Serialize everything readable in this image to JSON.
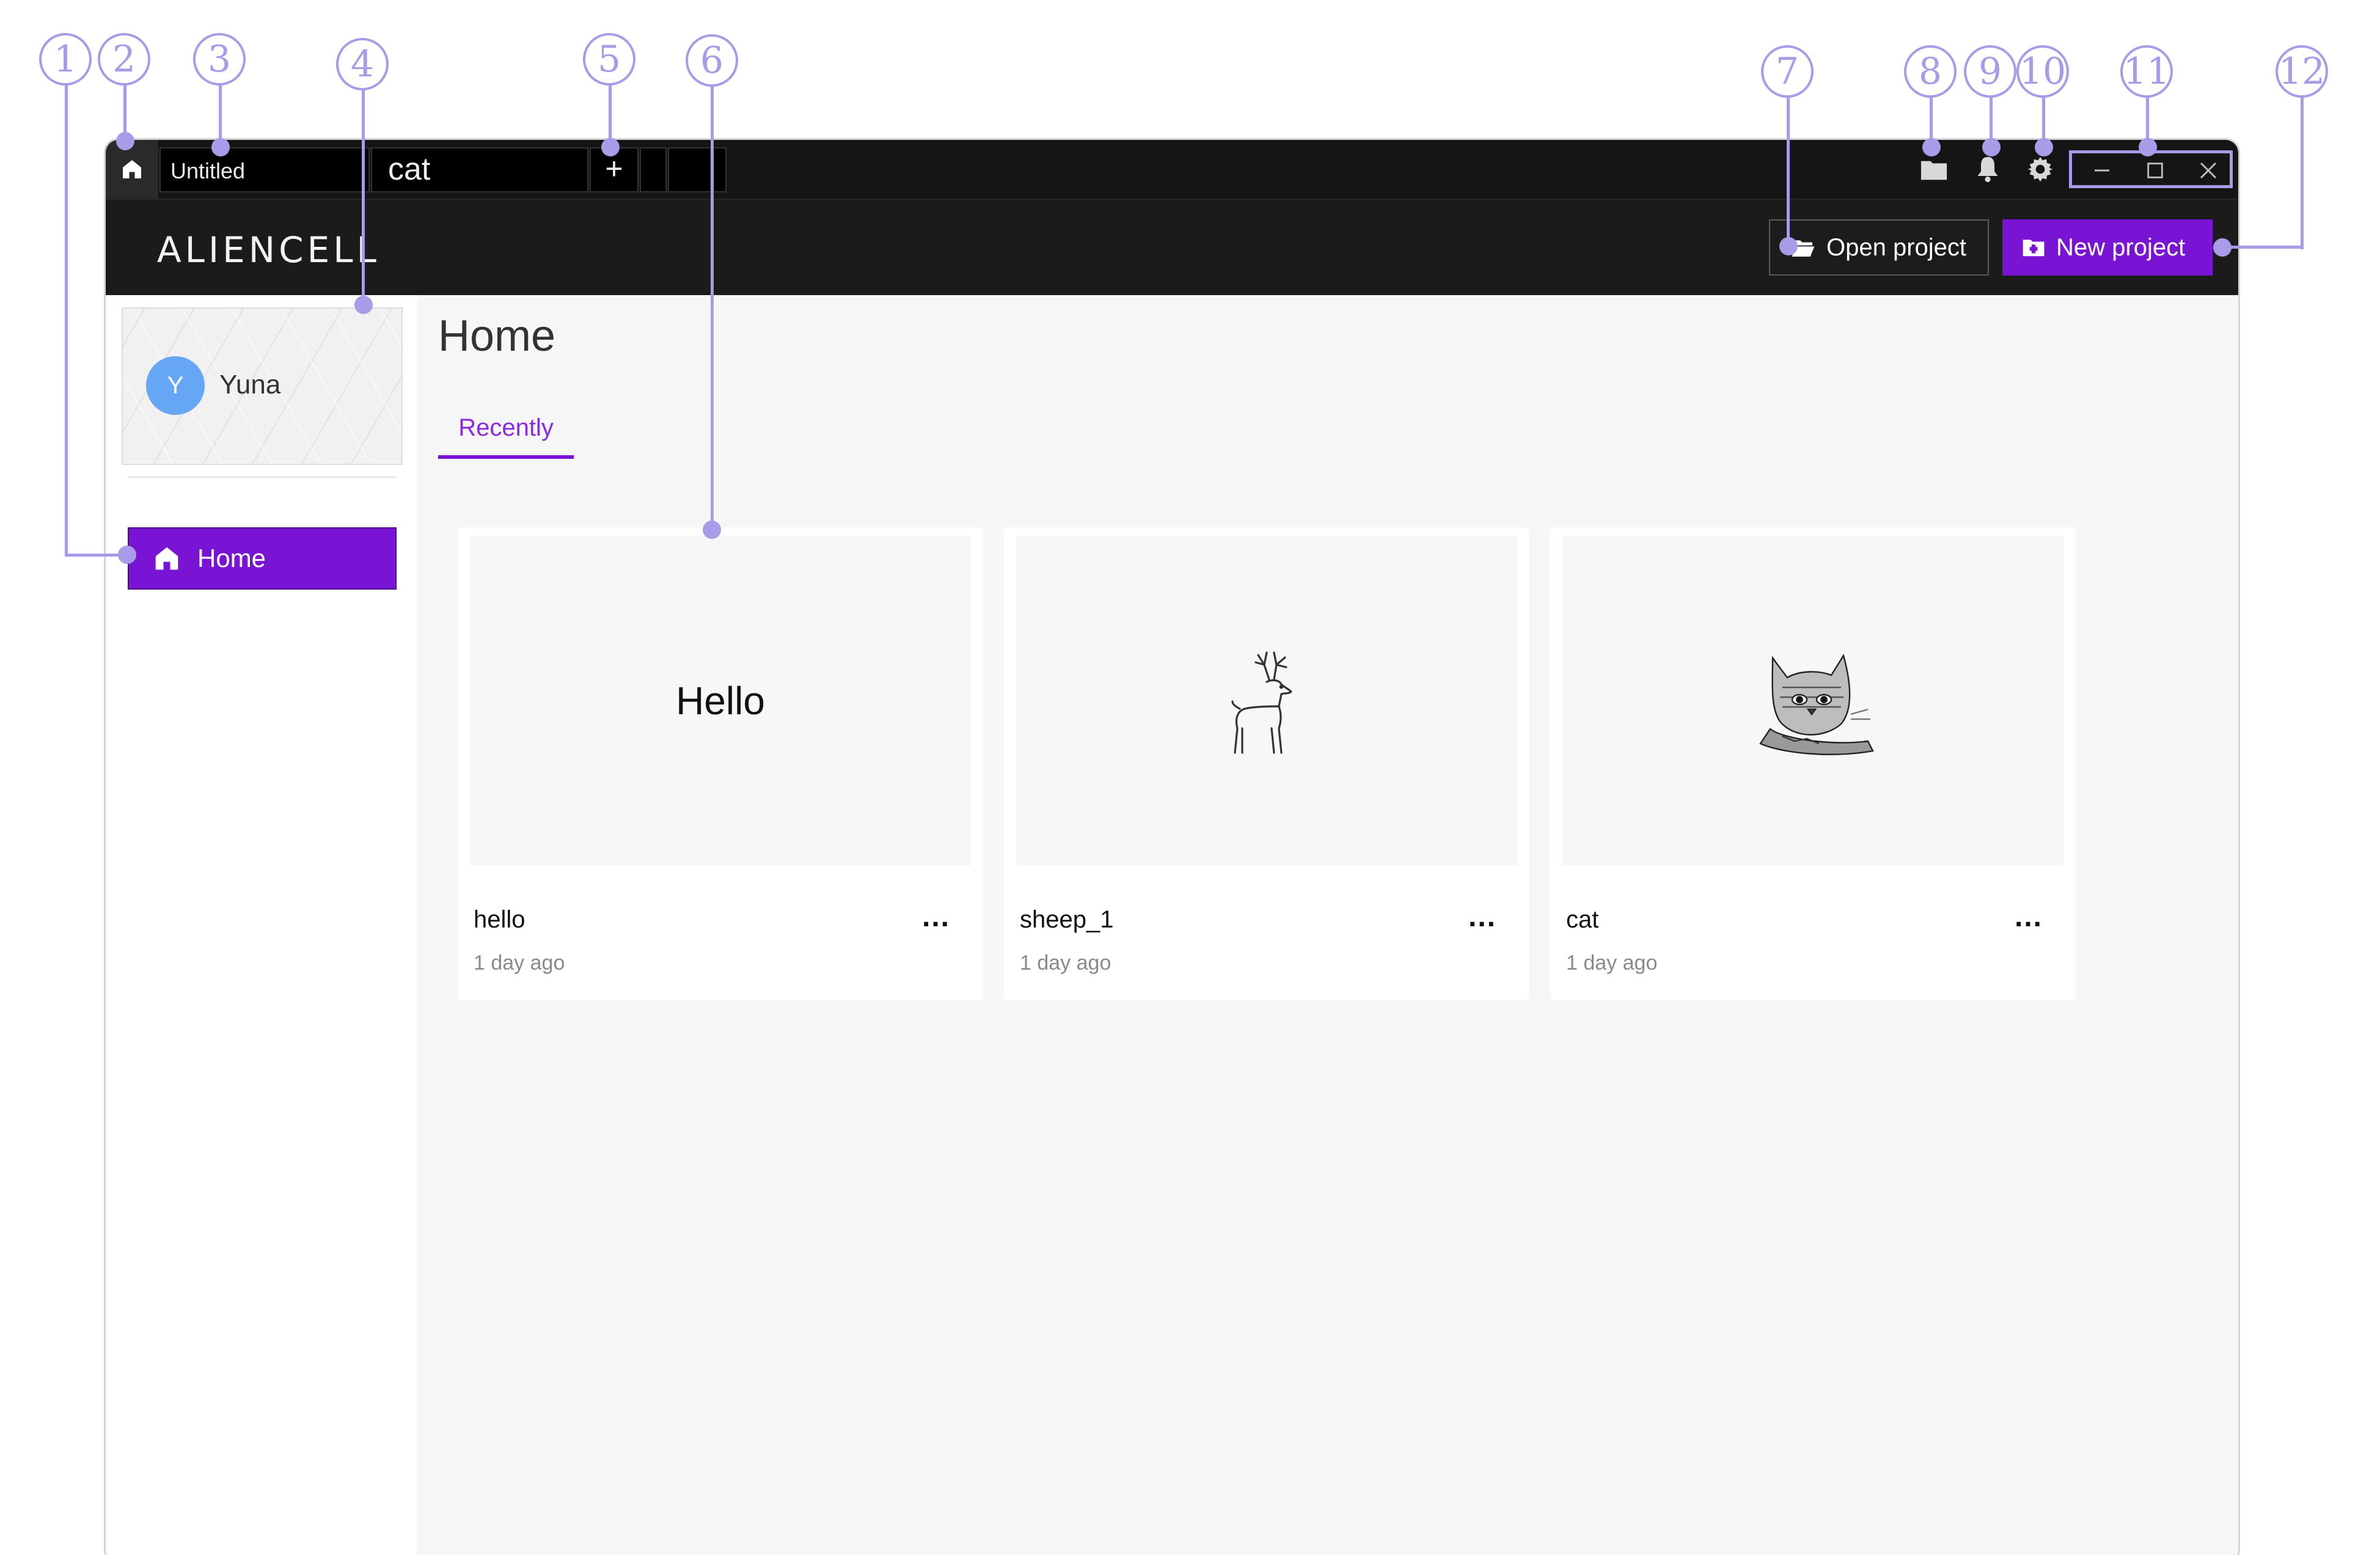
{
  "titlebar": {
    "tabs": [
      {
        "label": "Untitled"
      },
      {
        "label": "cat"
      }
    ],
    "add_tab_label": "+"
  },
  "header": {
    "logo_text": "ALIENCELL",
    "open_project_label": "Open project",
    "new_project_label": "New project"
  },
  "sidebar": {
    "user": {
      "initial": "Y",
      "name": "Yuna"
    },
    "nav": [
      {
        "label": "Home",
        "icon": "home-icon"
      }
    ]
  },
  "main": {
    "title": "Home",
    "tabs": [
      {
        "label": "Recently"
      }
    ],
    "projects": [
      {
        "name": "hello",
        "updated": "1 day ago",
        "thumbnail_text": "Hello"
      },
      {
        "name": "sheep_1",
        "updated": "1 day ago",
        "thumbnail": "deer-sketch"
      },
      {
        "name": "cat",
        "updated": "1 day ago",
        "thumbnail": "cat-sketch"
      }
    ],
    "more_label": "..."
  },
  "annotations": [
    "1",
    "2",
    "3",
    "4",
    "5",
    "6",
    "7",
    "8",
    "9",
    "10",
    "11",
    "12"
  ],
  "colors": {
    "accent": "#7a14d4",
    "annotation": "#a99be8",
    "titlebar": "#151515",
    "header": "#1b1b1b",
    "avatar": "#66a7f5"
  }
}
